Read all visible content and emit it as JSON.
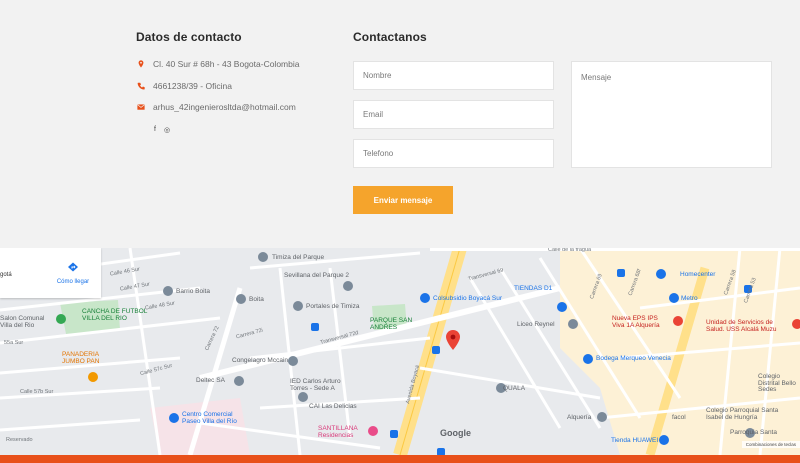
{
  "contact": {
    "heading": "Datos de contacto",
    "address": "Cl. 40 Sur # 68h - 43 Bogota-Colombia",
    "phone": "4661238/39 - Oficina",
    "email": "arhus_42ingenieroslt​da@hotmail.com",
    "social_facebook": "f",
    "social_instagram": "◎"
  },
  "form": {
    "heading": "Contactanos",
    "name_placeholder": "Nombre",
    "email_placeholder": "Email",
    "phone_placeholder": "Telefono",
    "message_placeholder": "Mensaje",
    "submit_label": "Enviar mensaje"
  },
  "map": {
    "directions_label": "Cómo llegar",
    "place_fragment": "gotá",
    "google_logo": "Google",
    "footer_text": "Combinaciones de teclas",
    "labels": {
      "timiza_parque": "Timiza del Parque",
      "sevillana": "Sevillana del Parque 2",
      "barrio_boita": "Barrio Boita",
      "boita": "Boita",
      "portales": "Portales de Timiza",
      "cancha": "CANCHA DE FUTBOL VILLA DEL RIO",
      "salon": "Salon Comunal Villa del Rio",
      "parque_san_andres": "PARQUE SAN ANDRES",
      "colsubsidio": "Colsubsidio Boyacá Sur",
      "tiendas_d1": "TIENDAS D1",
      "homecenter": "Homecenter",
      "metro": "Metro",
      "nueva_eps": "Nueva EPS IPS Viva 1A Alquería",
      "unidad_salud": "Unidad de Servicios de Salud. USS Alcalá Muzu",
      "liceo_reynel": "Liceo Reynel",
      "bodega": "Bodega Merqueo Venecia",
      "panaderia": "PANADERIA JUMBO PAN",
      "congelagro": "Congelagro Mccain",
      "deltec": "Deltec SA",
      "ied_carlos": "IED Carlos Arturo Torres - Sede A",
      "cai": "CAI Las Delicias",
      "quala": "QUALA",
      "centro_comercial": "Centro Comercial Paseo Villa del Río",
      "santillana": "SANTILLANA Residencias",
      "alqueria": "Alquería",
      "facol": "facol",
      "tienda_huawei": "Tienda HUAWEI",
      "colegio_bello": "Colegio Distrital Bello Sedes",
      "colegio_santa": "Colegio Parroquial Santa Isabel de Hungría",
      "parroquia": "Parroquia Santa",
      "calle_46": "Calle 46 Sur",
      "calle_47": "Calle 47 Sur",
      "calle_48": "Calle 48 Sur",
      "calle_55": "55a Sur",
      "calle_57b": "Calle 57b Sur",
      "calle_57c": "Calle 57c Sur",
      "carrera_72": "Carrera 72",
      "carrera_72i": "Carrera 72i",
      "transversal_72d": "Transversal 72d",
      "transversal_69": "Transversal 69",
      "avenida_boyaca": "Avenida Boyacá",
      "carrera_68": "Carrera 68",
      "calle_de_la_fragua": "Calle de la fragua",
      "reservado": "Reservado",
      "carrera_69": "Carrera 69",
      "carrera_68f": "Carrera 68f",
      "carrera_58": "Carrera 58",
      "carrera_53": "Carrera 53"
    }
  },
  "colors": {
    "accent": "#f5a42c",
    "bottom_bar": "#e8501a",
    "pin": "#ea4335"
  }
}
